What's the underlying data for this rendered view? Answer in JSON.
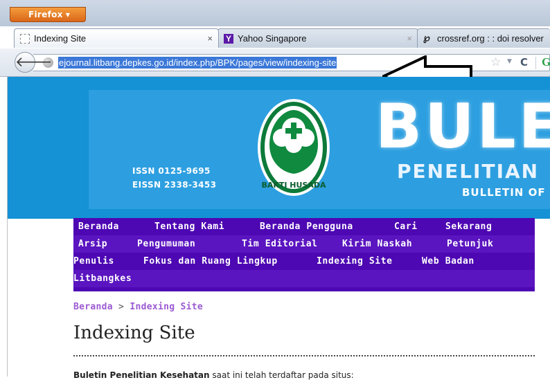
{
  "browser": {
    "menu_button_label": "Firefox",
    "tabs": [
      {
        "label": "Indexing Site",
        "close": "×",
        "active": true
      },
      {
        "label": "Yahoo Singapore",
        "close": "×",
        "active": false
      },
      {
        "label": "crossref.org : : doi resolver",
        "close": "×",
        "active": false
      }
    ],
    "url": "ejournal.litbang.depkes.go.id/index.php/BPK/pages/view/indexing-site"
  },
  "banner": {
    "issn": "ISSN 0125-9695",
    "eissn": "EISSN 2338-3453",
    "emblem_text": "BAKTI HUSADA",
    "title_big": "BULE",
    "title_sub": "PENELITIAN",
    "title_sub2": "BULLETIN OF"
  },
  "nav": {
    "items": [
      "Beranda",
      "Tentang Kami",
      "Beranda Pengguna",
      "Cari",
      "Sekarang",
      "Arsip",
      "Pengumuman",
      "Tim Editorial",
      "Kirim Naskah",
      "Petunjuk",
      "Penulis",
      "Fokus dan Ruang Lingkup",
      "Indexing Site",
      "Web Badan",
      "Litbangkes"
    ]
  },
  "breadcrumb": {
    "home": "Beranda",
    "separator": ">",
    "current": "Indexing Site"
  },
  "page": {
    "title": "Indexing Site",
    "intro_bold": "Buletin Penelitian Kesehatan",
    "intro_rest": " saat ini telah terdaftar pada situs:"
  },
  "colors": {
    "banner": "#1591d5",
    "nav": "#4d07b3",
    "breadcrumb": "#9c5bd3",
    "url_highlight": "#3b78d8"
  }
}
